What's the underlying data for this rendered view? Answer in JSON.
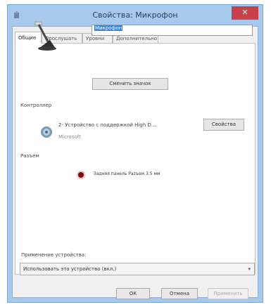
{
  "window": {
    "title": "Свойства: Микрофон",
    "close_label": "✕"
  },
  "tabs": [
    {
      "label": "Общие",
      "active": true
    },
    {
      "label": "Прослушать",
      "active": false
    },
    {
      "label": "Уровни",
      "active": false
    },
    {
      "label": "Дополнительно",
      "active": false
    }
  ],
  "device": {
    "name_value": "Микрофон",
    "change_icon_label": "Сменить значок"
  },
  "controller": {
    "section_label": "Контроллер",
    "name": "2- Устройство с поддержкой High D...",
    "vendor": "Microsoft",
    "properties_label": "Свойства"
  },
  "jack": {
    "section_label": "Разъем",
    "description": "Задняя панель Разъем 3.5 мм",
    "color": "#7b0e13"
  },
  "usage": {
    "label": "Применение устройства:",
    "selected": "Использовать это устройство (вкл.)"
  },
  "footer": {
    "ok": "ОК",
    "cancel": "Отмена",
    "apply": "Применить"
  }
}
